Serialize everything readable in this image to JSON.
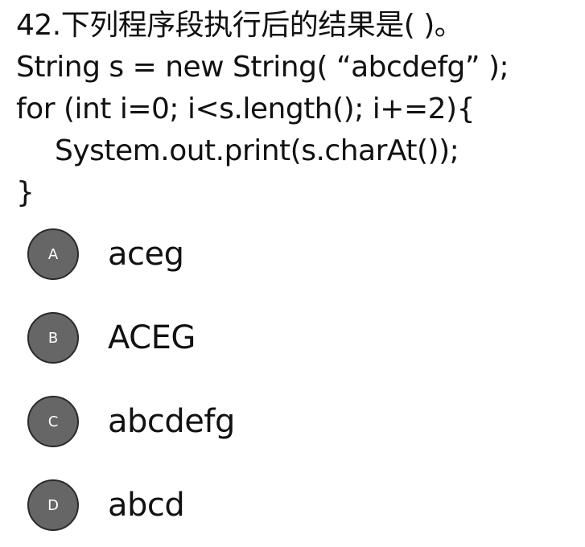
{
  "question": {
    "lines": [
      "42.下列程序段执行后的结果是( )。",
      "String s = new String( “abcdefg” );",
      "for (int i=0; i<s.length(); i+=2){",
      "System.out.print(s.charAt());",
      "}"
    ]
  },
  "options": [
    {
      "letter": "A",
      "text": "aceg"
    },
    {
      "letter": "B",
      "text": "ACEG"
    },
    {
      "letter": "C",
      "text": "abcdefg"
    },
    {
      "letter": "D",
      "text": "abcd"
    }
  ]
}
